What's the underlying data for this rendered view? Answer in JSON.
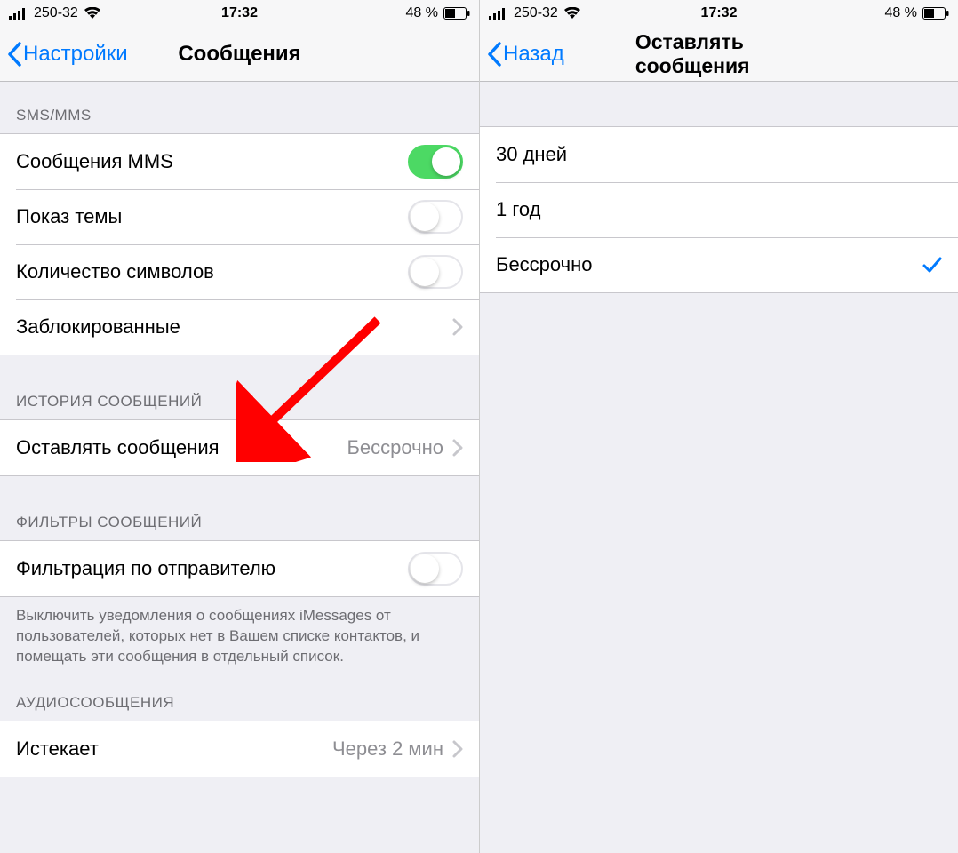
{
  "status": {
    "carrier": "250-32",
    "time": "17:32",
    "battery_text": "48 %"
  },
  "left_screen": {
    "back_label": "Настройки",
    "title": "Сообщения",
    "section_sms_header": "SMS/MMS",
    "rows": {
      "mms": "Сообщения MMS",
      "subject": "Показ темы",
      "charcount": "Количество символов",
      "blocked": "Заблокированные"
    },
    "section_history_header": "ИСТОРИЯ СООБЩЕНИЙ",
    "keep_row": {
      "label": "Оставлять сообщения",
      "value": "Бессрочно"
    },
    "section_filter_header": "ФИЛЬТРЫ СООБЩЕНИЙ",
    "filter_row": "Фильтрация по отправителю",
    "filter_footer": "Выключить уведомления о сообщениях iMessages от пользователей, которых нет в Вашем списке контактов, и помещать эти сообщения в отдельный список.",
    "section_audio_header": "АУДИОСООБЩЕНИЯ",
    "expire_row": {
      "label": "Истекает",
      "value": "Через 2 мин"
    },
    "switches": {
      "mms": true,
      "subject": false,
      "charcount": false,
      "filter": false
    }
  },
  "right_screen": {
    "back_label": "Назад",
    "title": "Оставлять сообщения",
    "options": [
      {
        "label": "30 дней",
        "selected": false
      },
      {
        "label": "1 год",
        "selected": false
      },
      {
        "label": "Бессрочно",
        "selected": true
      }
    ]
  },
  "colors": {
    "tint": "#007aff",
    "switch_on": "#4cd964",
    "arrow": "#ff0000"
  }
}
